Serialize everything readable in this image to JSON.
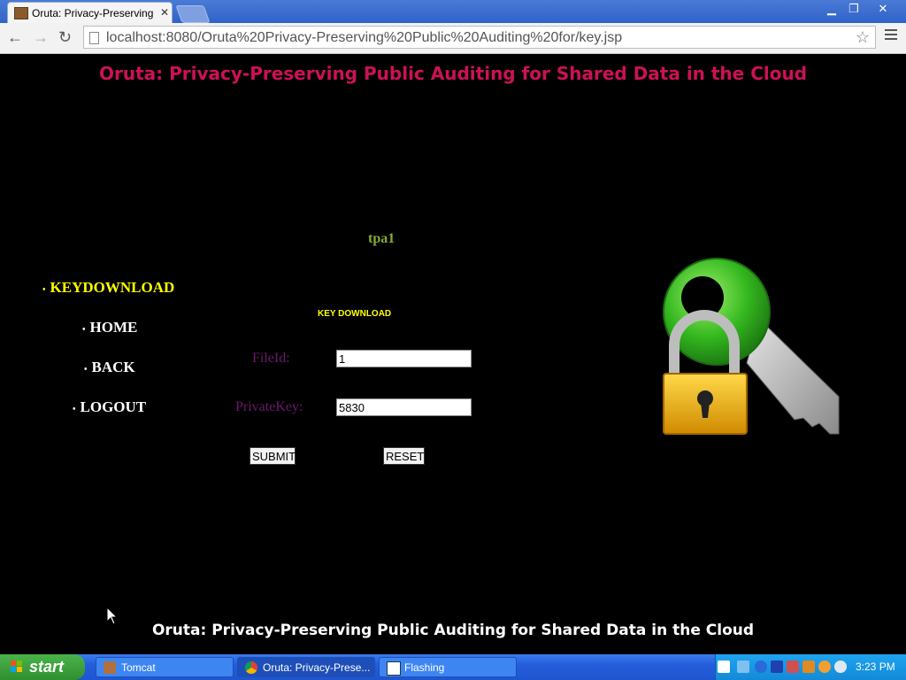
{
  "browser": {
    "tab_title": "Oruta: Privacy-Preserving Pu",
    "url": "localhost:8080/Oruta%20Privacy-Preserving%20Public%20Auditing%20for/key.jsp"
  },
  "page": {
    "heading": "Oruta: Privacy-Preserving Public Auditing for Shared Data in the Cloud",
    "user": "tpa1",
    "nav": [
      {
        "label": "KEYDOWNLOAD",
        "active": true
      },
      {
        "label": "HOME"
      },
      {
        "label": "BACK"
      },
      {
        "label": "LOGOUT"
      }
    ],
    "form": {
      "title": "KEY DOWNLOAD",
      "fileid_label": "FileId:",
      "fileid_value": "1",
      "privatekey_label": "PrivateKey:",
      "privatekey_value": "5830",
      "submit_label": "SUBMIT",
      "reset_label": "RESET"
    },
    "footer": "Oruta: Privacy-Preserving Public Auditing for Shared Data in the Cloud"
  },
  "taskbar": {
    "start_label": "start",
    "tasks": [
      {
        "label": "Tomcat"
      },
      {
        "label": "Oruta: Privacy-Prese...",
        "active": true
      },
      {
        "label": "Flashing"
      }
    ],
    "clock": "3:23 PM"
  },
  "colors": {
    "heading": "#cc1155",
    "active_nav": "#ffff00",
    "form_label": "#6a1a6a",
    "user": "#88aa33"
  }
}
